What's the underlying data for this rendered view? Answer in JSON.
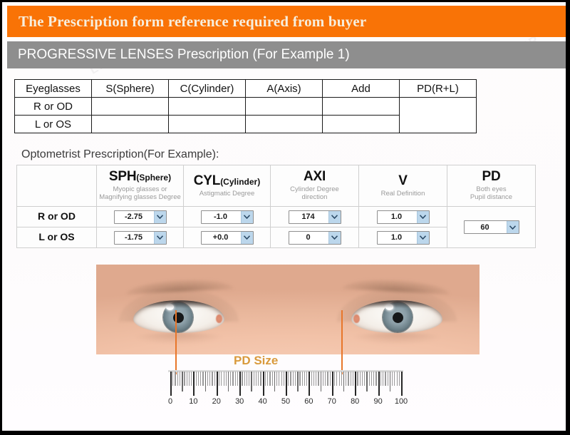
{
  "header": {
    "title": "The Prescription form reference required from buyer",
    "title_bg": "#f97306",
    "title_color": "#f7eedd",
    "subtitle": "PROGRESSIVE LENSES Prescription (For Example 1)",
    "subtitle_bg": "#8e8e8e",
    "subtitle_color": "#ffffff"
  },
  "blank_table": {
    "columns": [
      "Eyeglasses",
      "S(Sphere)",
      "C(Cylinder)",
      "A(Axis)",
      "Add",
      "PD(R+L)"
    ],
    "rows": [
      {
        "label": "R or OD",
        "sphere": "",
        "cylinder": "",
        "axis": "",
        "add": ""
      },
      {
        "label": "L or OS",
        "sphere": "",
        "cylinder": "",
        "axis": "",
        "add": ""
      }
    ],
    "pd_merged_value": ""
  },
  "example_table": {
    "caption": "Optometrist Prescription(For Example):",
    "columns": [
      {
        "main": "",
        "small": "",
        "sub": ""
      },
      {
        "main": "SPH",
        "small": "(Sphere)",
        "sub": "Myopic glasses or\nMagnifying glasses Degree"
      },
      {
        "main": "CYL",
        "small": "(Cylinder)",
        "sub": "Astigmatic  Degree"
      },
      {
        "main": "AXI",
        "small": "",
        "sub": "Cylinder Degree\ndirection"
      },
      {
        "main": "V",
        "small": "",
        "sub": "Real Definition"
      },
      {
        "main": "PD",
        "small": "",
        "sub": "Both eyes\nPupil distance"
      }
    ],
    "rows": [
      {
        "label": "R or OD",
        "sph": "-2.75",
        "cyl": "-1.0",
        "axi": "174",
        "v": "1.0"
      },
      {
        "label": "L or OS",
        "sph": "-1.75",
        "cyl": "+0.0",
        "axi": "0",
        "v": "1.0"
      }
    ],
    "pd_merged_value": "60",
    "select_arrow_color": "#bcd7ec"
  },
  "diagram": {
    "pd_size_label": "PD Size",
    "pd_label_color": "#d99a3c",
    "measure_line_color": "#e8762a",
    "ruler": {
      "min": 0,
      "max": 100,
      "label_step": 10,
      "major_step": 5,
      "minor_step": 1,
      "labels": [
        "0",
        "10",
        "20",
        "30",
        "40",
        "50",
        "60",
        "70",
        "80",
        "90",
        "100"
      ]
    }
  },
  "watermark": "LASER"
}
